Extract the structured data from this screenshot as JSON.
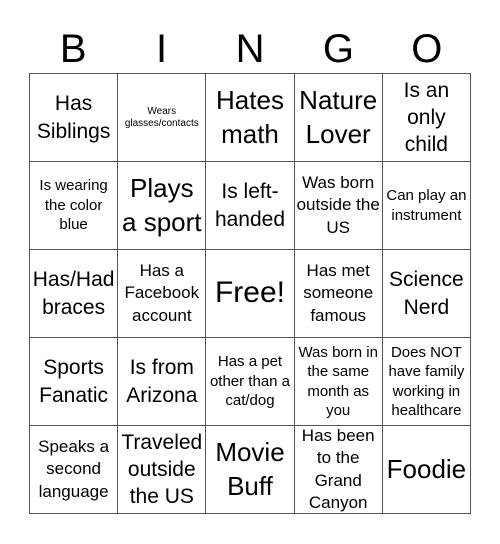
{
  "header": [
    "B",
    "I",
    "N",
    "G",
    "O"
  ],
  "cells": [
    {
      "text": "Has Siblings",
      "size": "lg"
    },
    {
      "text": "Wears glasses/contacts",
      "size": "xs"
    },
    {
      "text": "Hates math",
      "size": "xl"
    },
    {
      "text": "Nature Lover",
      "size": "xl"
    },
    {
      "text": "Is an only child",
      "size": "lg"
    },
    {
      "text": "Is wearing the color blue",
      "size": "sm"
    },
    {
      "text": "Plays a sport",
      "size": "xl"
    },
    {
      "text": "Is left-handed",
      "size": "lg"
    },
    {
      "text": "Was born outside the US",
      "size": "md"
    },
    {
      "text": "Can play an instrument",
      "size": "sm"
    },
    {
      "text": "Has/Had braces",
      "size": "lg"
    },
    {
      "text": "Has a Facebook account",
      "size": "md"
    },
    {
      "text": "Free!",
      "size": "xxl"
    },
    {
      "text": "Has met someone famous",
      "size": "md"
    },
    {
      "text": "Science Nerd",
      "size": "lg"
    },
    {
      "text": "Sports Fanatic",
      "size": "lg"
    },
    {
      "text": "Is from Arizona",
      "size": "lg"
    },
    {
      "text": "Has a pet other than a cat/dog",
      "size": "sm"
    },
    {
      "text": "Was born in the same month as you",
      "size": "sm"
    },
    {
      "text": "Does NOT have family working in healthcare",
      "size": "sm"
    },
    {
      "text": "Speaks a second language",
      "size": "md"
    },
    {
      "text": "Traveled outside the US",
      "size": "lg"
    },
    {
      "text": "Movie Buff",
      "size": "xl"
    },
    {
      "text": "Has been to the Grand Canyon",
      "size": "md"
    },
    {
      "text": "Foodie",
      "size": "xl"
    }
  ]
}
